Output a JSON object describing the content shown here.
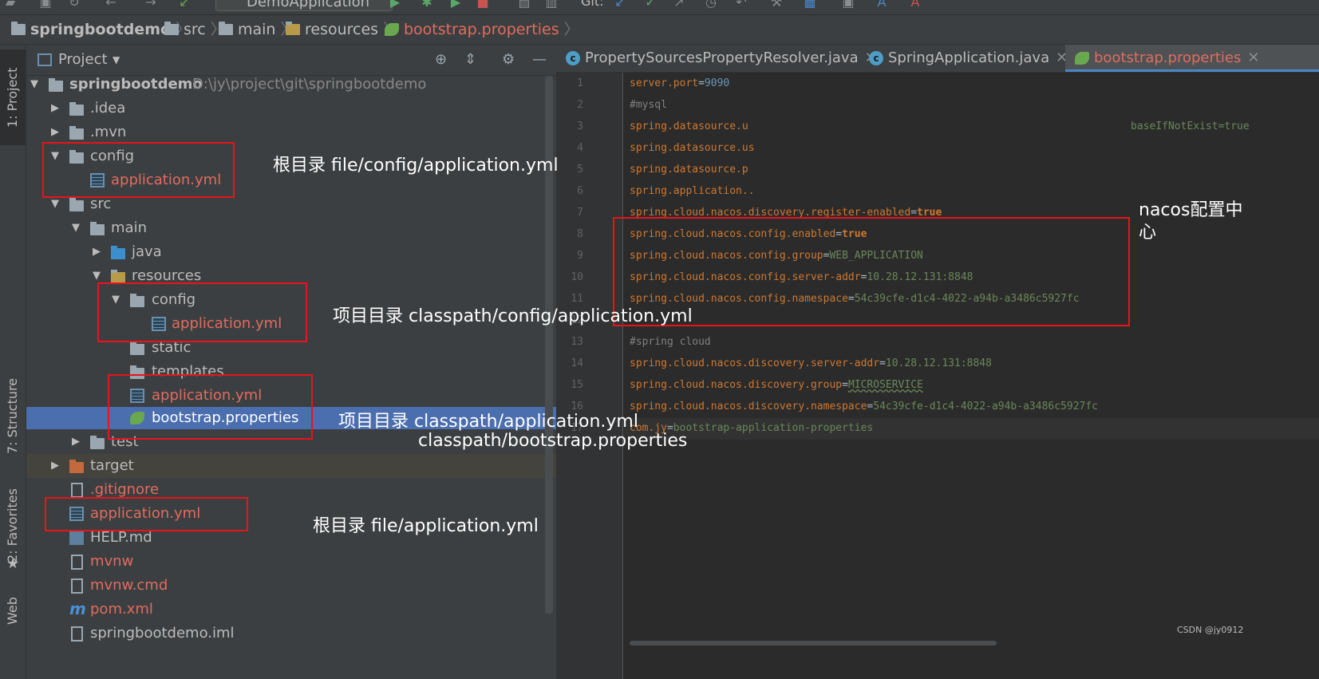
{
  "toolbar": {
    "run_config": "DemoApplication",
    "git_label": "Git:"
  },
  "breadcrumb": [
    {
      "label": "springbootdemo",
      "kind": "project"
    },
    {
      "label": "src",
      "kind": "folder"
    },
    {
      "label": "main",
      "kind": "folder"
    },
    {
      "label": "resources",
      "kind": "folder"
    },
    {
      "label": "bootstrap.properties",
      "kind": "file"
    }
  ],
  "side_tabs": {
    "project": "1: Project",
    "structure": "7: Structure",
    "favorites": "2: Favorites",
    "web": "Web"
  },
  "project_panel": {
    "title": "Project",
    "tree": [
      {
        "label": "springbootdemo",
        "path": "D:\\jy\\project\\git\\springbootdemo"
      },
      {
        "label": ".idea"
      },
      {
        "label": ".mvn"
      },
      {
        "label": "config"
      },
      {
        "label": "application.yml"
      },
      {
        "label": "src"
      },
      {
        "label": "main"
      },
      {
        "label": "java"
      },
      {
        "label": "resources"
      },
      {
        "label": "config"
      },
      {
        "label": "application.yml"
      },
      {
        "label": "static"
      },
      {
        "label": "templates"
      },
      {
        "label": "application.yml"
      },
      {
        "label": "bootstrap.properties"
      },
      {
        "label": "test"
      },
      {
        "label": "target"
      },
      {
        "label": ".gitignore"
      },
      {
        "label": "application.yml"
      },
      {
        "label": "HELP.md"
      },
      {
        "label": "mvnw"
      },
      {
        "label": "mvnw.cmd"
      },
      {
        "label": "pom.xml"
      },
      {
        "label": "springbootdemo.iml"
      }
    ]
  },
  "editor": {
    "tabs": [
      {
        "label": "PropertySourcesPropertyResolver.java"
      },
      {
        "label": "SpringApplication.java"
      },
      {
        "label": "bootstrap.properties"
      }
    ],
    "lines": [
      {
        "n": "1",
        "key": "server.port",
        "eq": "=",
        "value": "9090"
      },
      {
        "n": "2",
        "comment": "#mysql"
      },
      {
        "n": "3",
        "key": "spring.datasource.u",
        "tail": "baseIfNotExist=true"
      },
      {
        "n": "4",
        "key": "spring.datasource.us"
      },
      {
        "n": "5",
        "key": "spring.datasource.p"
      },
      {
        "n": "6",
        "key": "spring.application.."
      },
      {
        "n": "7",
        "key": "spring.cloud.nacos.discovery.register-enabled",
        "eq": "=",
        "value": "true"
      },
      {
        "n": "8",
        "key": "spring.cloud.nacos.config.enabled",
        "eq": "=",
        "value": "true"
      },
      {
        "n": "9",
        "key": "spring.cloud.nacos.config.group",
        "eq": "=",
        "value": "WEB_APPLICATION"
      },
      {
        "n": "10",
        "key": "spring.cloud.nacos.config.server-addr",
        "eq": "=",
        "value": "10.28.12.131:8848"
      },
      {
        "n": "11",
        "key": "spring.cloud.nacos.config.namespace",
        "eq": "=",
        "value": "54c39cfe-d1c4-4022-a94b-a3486c5927fc"
      },
      {
        "n": "12"
      },
      {
        "n": "13",
        "comment": "#spring cloud"
      },
      {
        "n": "14",
        "key": "spring.cloud.nacos.discovery.server-addr",
        "eq": "=",
        "value": "10.28.12.131:8848"
      },
      {
        "n": "15",
        "key": "spring.cloud.nacos.discovery.group",
        "eq": "=",
        "value": "MICROSERVICE"
      },
      {
        "n": "16",
        "key": "spring.cloud.nacos.discovery.namespace",
        "eq": "=",
        "value": "54c39cfe-d1c4-4022-a94b-a3486c5927fc"
      },
      {
        "n": "17",
        "key": "com.jy",
        "eq": "=",
        "value": "bootstrap-application-properties"
      }
    ]
  },
  "annotations": {
    "root_config": "根目录 file/config/application.yml",
    "nacos": "nacos配置中心",
    "classpath_config": "项目目录  classpath/config/application.yml",
    "classpath_app": "项目目录 classpath/application.yml",
    "classpath_bootstrap": "classpath/bootstrap.properties",
    "root_app": "根目录 file/application.yml"
  },
  "watermark": "CSDN @jy0912",
  "colors": {
    "annotation_red": "#e8141b",
    "selection_blue": "#4b6eaf",
    "modified_file": "#e06c5f"
  }
}
